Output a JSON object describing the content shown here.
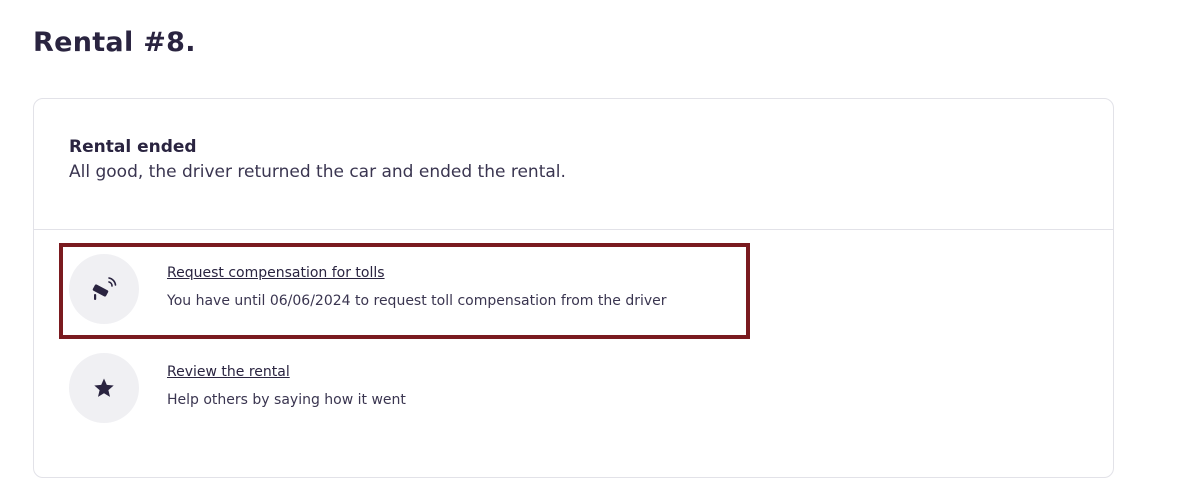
{
  "page": {
    "title": "Rental #8."
  },
  "status": {
    "title": "Rental ended",
    "description": "All good, the driver returned the car and ended the rental."
  },
  "actions": [
    {
      "icon": "toll-camera-icon",
      "label": "Request compensation for tolls",
      "subtext": "You have until 06/06/2024 to request toll compensation from the driver"
    },
    {
      "icon": "star-icon",
      "label": "Review the rental",
      "subtext": "Help others by saying how it went"
    }
  ],
  "colors": {
    "text": "#2a2440",
    "highlight": "#7a1a1f",
    "icon_bg": "#f0f0f3",
    "border": "#e2e2e8"
  }
}
